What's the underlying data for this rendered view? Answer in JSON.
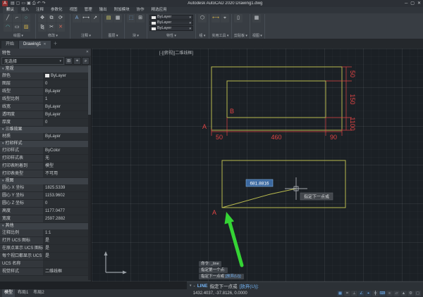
{
  "colors": {
    "line": "#b9ba4e",
    "dimension": "#e04444",
    "arrow": "#35d435",
    "accent": "#74b4f5"
  },
  "titlebar": {
    "logo": "A",
    "quick_access": [
      {
        "name": "app-menu-icon",
        "glyph": "▤"
      },
      {
        "name": "new-file-icon",
        "glyph": "▢"
      },
      {
        "name": "open-file-icon",
        "glyph": "▭"
      },
      {
        "name": "save-icon",
        "glyph": "▣"
      },
      {
        "name": "print-icon",
        "glyph": "⎙"
      },
      {
        "name": "undo-icon",
        "glyph": "↶"
      },
      {
        "name": "redo-icon",
        "glyph": "↷"
      }
    ],
    "title": "Autodesk AutoCAD 2020 Drawing1.dwg",
    "window_controls": [
      {
        "name": "minimize-icon",
        "glyph": "─"
      },
      {
        "name": "maximize-icon",
        "glyph": "▢"
      },
      {
        "name": "close-icon",
        "glyph": "✕"
      }
    ]
  },
  "ribbon": {
    "tabs": [
      "默认",
      "插入",
      "注释",
      "参数化",
      "视图",
      "管理",
      "输出",
      "附加模块",
      "协作",
      "精选应用"
    ],
    "active_tab": "默认",
    "group_chevron": "▾",
    "bylayer_label": "ByLayer",
    "groups": [
      {
        "label": "绘图",
        "icons": [
          {
            "name": "line-icon",
            "glyph": "╱",
            "color": "#cfd3d7"
          },
          {
            "name": "polyline-icon",
            "glyph": "⌐",
            "color": "#cfd3d7"
          },
          {
            "name": "circle-icon",
            "glyph": "○",
            "color": "#5bb0ae"
          },
          {
            "name": "arc-icon",
            "glyph": "◠",
            "color": "#5bb0ae"
          },
          {
            "name": "rectangle-icon",
            "glyph": "▭",
            "color": "#cfd3d7"
          },
          {
            "name": "hatch-icon",
            "glyph": "▨",
            "color": "#d2b24a"
          }
        ]
      },
      {
        "label": "修改",
        "icons": [
          {
            "name": "move-icon",
            "glyph": "✥",
            "color": "#cfd3d7"
          },
          {
            "name": "copy-icon",
            "glyph": "⧉",
            "color": "#cfd3d7"
          },
          {
            "name": "rotate-icon",
            "glyph": "⟳",
            "color": "#cfd3d7"
          },
          {
            "name": "mirror-icon",
            "glyph": "⧎",
            "color": "#cfd3d7"
          },
          {
            "name": "trim-icon",
            "glyph": "✂",
            "color": "#cfd3d7"
          },
          {
            "name": "erase-icon",
            "glyph": "✕",
            "color": "#d26a5a"
          }
        ]
      },
      {
        "label": "注释",
        "icons": [
          {
            "name": "text-icon",
            "glyph": "A",
            "color": "#7aa7d9"
          },
          {
            "name": "dimension-icon",
            "glyph": "⟷",
            "color": "#cfd3d7"
          },
          {
            "name": "leader-icon",
            "glyph": "↗",
            "color": "#cfd3d7"
          }
        ]
      },
      {
        "label": "图层",
        "icons": [
          {
            "name": "layer-properties-icon",
            "glyph": "▤",
            "color": "#d8d36a"
          },
          {
            "name": "layer-list-icon",
            "glyph": "▦",
            "color": "#cfd3d7"
          }
        ]
      },
      {
        "label": "块",
        "icons": [
          {
            "name": "insert-block-icon",
            "glyph": "⬚",
            "color": "#7aa7d9"
          },
          {
            "name": "create-block-icon",
            "glyph": "⊞",
            "color": "#cfd3d7"
          }
        ]
      },
      {
        "label": "特性",
        "bylayer": true
      },
      {
        "label": "组",
        "icons": [
          {
            "name": "group-icon",
            "glyph": "⬡",
            "color": "#cfd3d7"
          }
        ]
      },
      {
        "label": "实用工具",
        "icons": [
          {
            "name": "measure-icon",
            "glyph": "⟷",
            "color": "#d2b24a"
          },
          {
            "name": "id-point-icon",
            "glyph": "⌖",
            "color": "#cfd3d7"
          }
        ]
      },
      {
        "label": "剪贴板",
        "icons": [
          {
            "name": "paste-icon",
            "glyph": "▯",
            "color": "#cfd3d7"
          }
        ]
      },
      {
        "label": "视图",
        "icons": [
          {
            "name": "view-icon",
            "glyph": "▦",
            "color": "#cfd3d7"
          }
        ]
      }
    ]
  },
  "file_tabs": {
    "start": "开始",
    "document": "Drawing1",
    "close_glyph": "✕",
    "new_glyph": "＋"
  },
  "properties_panel": {
    "title": "特性",
    "close_glyph": "✕",
    "chevron": "▾",
    "selection": "无选择",
    "buttons": [
      {
        "name": "toggle-pickadd-icon",
        "glyph": "⊞"
      },
      {
        "name": "select-objects-icon",
        "glyph": "⌖"
      },
      {
        "name": "quick-select-icon",
        "glyph": "⌕"
      }
    ],
    "sections": [
      {
        "label": "常规",
        "rows": [
          {
            "label": "颜色",
            "value": "ByLayer",
            "swatch": "#e8e8e8"
          },
          {
            "label": "图层",
            "value": "0"
          },
          {
            "label": "线型",
            "value": "ByLayer"
          },
          {
            "label": "线型比例",
            "value": "1"
          },
          {
            "label": "线宽",
            "value": "ByLayer"
          },
          {
            "label": "透明度",
            "value": "ByLayer"
          },
          {
            "label": "厚度",
            "value": "0"
          }
        ]
      },
      {
        "label": "三维效果",
        "rows": [
          {
            "label": "材质",
            "value": "ByLayer"
          }
        ]
      },
      {
        "label": "打印样式",
        "rows": [
          {
            "label": "打印样式",
            "value": "ByColor"
          },
          {
            "label": "打印样式表",
            "value": "无"
          },
          {
            "label": "打印表附着到",
            "value": "模型"
          },
          {
            "label": "打印表类型",
            "value": "不可用"
          }
        ]
      },
      {
        "label": "视图",
        "rows": [
          {
            "label": "圆心 X 坐标",
            "value": "1825.5339"
          },
          {
            "label": "圆心 Y 坐标",
            "value": "1153.9602"
          },
          {
            "label": "圆心 Z 坐标",
            "value": "0"
          },
          {
            "label": "高度",
            "value": "1177.0477"
          },
          {
            "label": "宽度",
            "value": "2597.2882"
          }
        ]
      },
      {
        "label": "其他",
        "rows": [
          {
            "label": "注释比例",
            "value": "1:1"
          },
          {
            "label": "打开 UCS 图标",
            "value": "是"
          },
          {
            "label": "在原点显示 UCS 图标",
            "value": "是"
          },
          {
            "label": "每个视口都显示 UCS 图标",
            "value": "是"
          },
          {
            "label": "UCS 名称",
            "value": ""
          },
          {
            "label": "视觉样式",
            "value": "二维线框"
          }
        ]
      }
    ]
  },
  "viewport": {
    "controls": "[-][俯视][二维线框]"
  },
  "drawing": {
    "top_figure": {
      "label_a": "A",
      "label_b": "B",
      "bottom_dims": [
        "50",
        "460",
        "90"
      ],
      "right_dims": [
        "50",
        "150",
        "1100"
      ]
    },
    "bottom_figure": {
      "label_a": "A",
      "dyn_value": "681.8816",
      "dyn_prompt": "指定下一点或"
    }
  },
  "command_history": {
    "line1": "命令: _line",
    "line2": "指定第一个点:",
    "line3_text": "指定下一点或 ",
    "line3_option": "[放弃(U)]:"
  },
  "command_line": {
    "history_glyph": "▾",
    "prefix": "-",
    "command": "LINE",
    "prompt_text": "指定下一点或",
    "prompt_option": "[放弃(U)]:"
  },
  "status_bar": {
    "tabs": [
      "模型",
      "布局1",
      "布局2"
    ],
    "active_tab": "模型",
    "coords": "1432.4037, -37.8126, 0.0000",
    "icons": [
      {
        "name": "grid-icon",
        "glyph": "▦",
        "active": true
      },
      {
        "name": "snap-icon",
        "glyph": "⌗",
        "active": false
      },
      {
        "name": "ortho-icon",
        "glyph": "⟂",
        "active": false
      },
      {
        "name": "polar-tracking-icon",
        "glyph": "∠",
        "active": true
      },
      {
        "name": "osnap-icon",
        "glyph": "⌖",
        "active": true
      },
      {
        "name": "object-snap-tracking-icon",
        "glyph": "╋",
        "active": false
      },
      {
        "name": "dynamic-input-icon",
        "glyph": "⌨",
        "active": true
      },
      {
        "name": "lineweight-icon",
        "glyph": "≡",
        "active": false
      },
      {
        "name": "transparency-icon",
        "glyph": "▱",
        "active": false
      },
      {
        "name": "annotation-scale-icon",
        "glyph": "▲",
        "active": false
      },
      {
        "name": "workspace-icon",
        "glyph": "⚙",
        "active": false
      },
      {
        "name": "clean-screen-icon",
        "glyph": "▢",
        "active": false
      }
    ]
  }
}
